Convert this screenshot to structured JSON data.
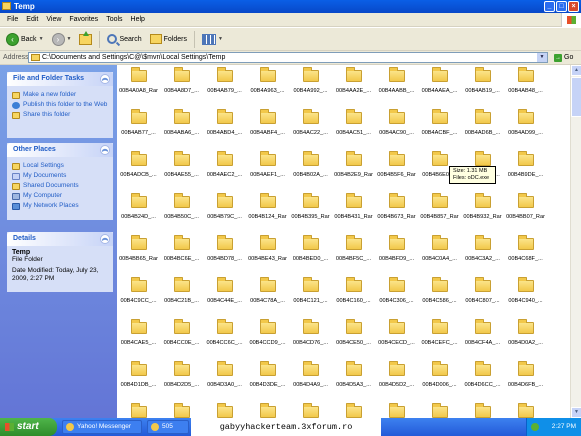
{
  "window": {
    "title": "Temp"
  },
  "menu": [
    "File",
    "Edit",
    "View",
    "Favorites",
    "Tools",
    "Help"
  ],
  "toolbar": {
    "back": "Back",
    "search": "Search",
    "folders": "Folders"
  },
  "address": {
    "label": "Address",
    "path": "C:\\Documents and Settings\\C@\\$mvn\\Local Settings\\Temp",
    "go": "Go"
  },
  "tasks": {
    "title": "File and Folder Tasks",
    "items": [
      "Make a new folder",
      "Publish this folder to the Web",
      "Share this folder"
    ]
  },
  "places": {
    "title": "Other Places",
    "items": [
      "Local Settings",
      "My Documents",
      "Shared Documents",
      "My Computer",
      "My Network Places"
    ]
  },
  "details": {
    "title": "Details",
    "name": "Temp",
    "type": "File Folder",
    "modified": "Date Modified: Today, July 23, 2009, 2:27 PM"
  },
  "tooltip": {
    "size": "Size: 1.31 MB",
    "files": "Files: oDC.exe"
  },
  "files": [
    "00B4A0A8_Rar",
    "00B4A8D7_...",
    "00B4AB79_...",
    "00B4A963_...",
    "00B4A992_...",
    "00B4AA2E_...",
    "00B4AABB_...",
    "00B4AAEA_...",
    "00B4AB19_...",
    "00B4AB48_...",
    "00B4AB77_...",
    "00B4ABA6_...",
    "00B4ABD4_...",
    "00B4ABF4_...",
    "00B4AC22_...",
    "00B4AC51_...",
    "00B4AC90_...",
    "00B4ACBF_...",
    "00B4AD6B_...",
    "00B4AD99_...",
    "00B4ADCB_...",
    "00B4AE55_...",
    "00B4AEC2_...",
    "00B4AEF1_...",
    "00B4B02A_...",
    "00B4B2E9_Rar",
    "00B4B5F6_Rar",
    "00B4B6E0_...",
    "00B4B8A5_...",
    "00B4B9DE_...",
    "00B4B24D_...",
    "00B4B50C_...",
    "00B4B79C_...",
    "00B4B124_Rar",
    "00B4B395_Rar",
    "00B4B431_Rar",
    "00B4B673_Rar",
    "00B4B857_Rar",
    "00B4B932_Rar",
    "00B4BB07_Rar",
    "00B4BB65_Rar",
    "00B4BC6E_...",
    "00B4BD78_...",
    "00B4BE43_Rar",
    "00B4BED0_...",
    "00B4BF5C_...",
    "00B4BFD9_...",
    "00B4C0A4_...",
    "00B4C3A2_...",
    "00B4C68F_...",
    "00B4C9CC_...",
    "00B4C21B_...",
    "00B4C44E_...",
    "00B4C78A_...",
    "00B4C121_...",
    "00B4C160_...",
    "00B4C306_...",
    "00B4C586_...",
    "00B4C807_...",
    "00B4C940_...",
    "00B4CAE5_...",
    "00B4CC0E_...",
    "00B4CC6C_...",
    "00B4CCD9_...",
    "00B4CD76_...",
    "00B4CE50_...",
    "00B4CECD_...",
    "00B4CEFC_...",
    "00B4CF4A_...",
    "00B4D0A2_...",
    "00B4D1DB_...",
    "00B4D2D5_...",
    "00B4D3A0_...",
    "00B4D3DE_...",
    "00B4D4A9_...",
    "00B4D5A3_...",
    "00B4D5D2_...",
    "00B4D006_...",
    "00B4D6CC_...",
    "00B4D6FB_...",
    "",
    "",
    "",
    "",
    "",
    "",
    "",
    "",
    "",
    ""
  ],
  "taskbar": {
    "start": "start",
    "tasks": [
      "Yahoo! Messenger",
      "505"
    ],
    "clock": "2:27 PM"
  },
  "watermark": "gabyyhackerteam.3xforum.ro"
}
